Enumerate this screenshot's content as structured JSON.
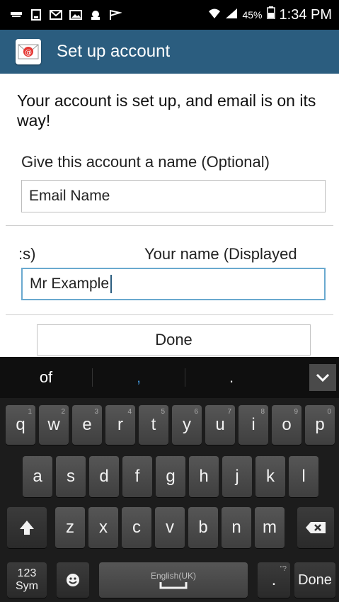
{
  "status_bar": {
    "left_icons": [
      "usb-icon",
      "storage-icon",
      "gmail-icon",
      "gallery-icon",
      "android-icon",
      "flag-icon"
    ],
    "battery_percent": "45%",
    "time": "1:34 PM"
  },
  "action_bar": {
    "title": "Set up account",
    "app_icon": "email-app-icon",
    "color": "#2b5d7f"
  },
  "content": {
    "message": "Your account is set up, and email is on its way!",
    "account_name_label": "Give this account a name (Optional)",
    "account_name_value": "Email Name",
    "your_name_label_left": ":s)",
    "your_name_label": "Your name (Displayed",
    "your_name_value": "Mr Example",
    "done_label": "Done"
  },
  "keyboard": {
    "suggestions": [
      "of",
      ",",
      "."
    ],
    "row1": [
      {
        "k": "q",
        "n": "1"
      },
      {
        "k": "w",
        "n": "2"
      },
      {
        "k": "e",
        "n": "3"
      },
      {
        "k": "r",
        "n": "4"
      },
      {
        "k": "t",
        "n": "5"
      },
      {
        "k": "y",
        "n": "6"
      },
      {
        "k": "u",
        "n": "7"
      },
      {
        "k": "i",
        "n": "8"
      },
      {
        "k": "o",
        "n": "9"
      },
      {
        "k": "p",
        "n": "0"
      }
    ],
    "row2": [
      "a",
      "s",
      "d",
      "f",
      "g",
      "h",
      "j",
      "k",
      "l"
    ],
    "row3": [
      "z",
      "x",
      "c",
      "v",
      "b",
      "n",
      "m"
    ],
    "sym_label_1": "123",
    "sym_label_2": "Sym",
    "space_label": "English(UK)",
    "period_label": ".",
    "period_sub": "\"?",
    "done_label": "Done"
  }
}
